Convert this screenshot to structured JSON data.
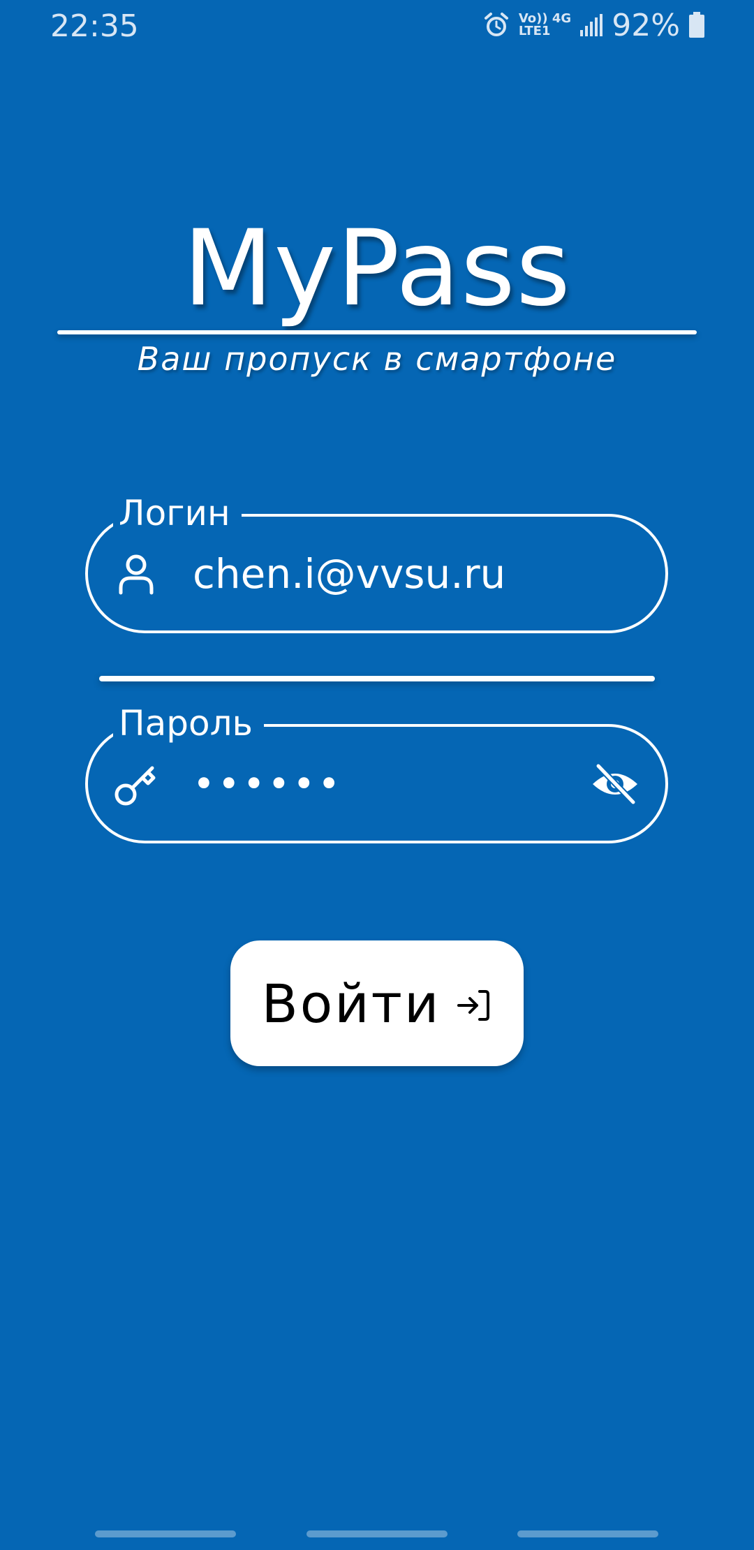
{
  "status_bar": {
    "time": "22:35",
    "network_top": "Vo)) 4G",
    "network_bottom": "LTE1",
    "battery": "92%",
    "icons": [
      "alarm-icon",
      "signal-icon",
      "battery-icon"
    ]
  },
  "header": {
    "title": "MyPass",
    "subtitle": "Ваш пропуск в смартфоне"
  },
  "login_field": {
    "label": "Логин",
    "value": "chen.i@vvsu.ru",
    "icon": "person-icon"
  },
  "password_field": {
    "label": "Пароль",
    "value": "••••••",
    "icon": "key-icon",
    "toggle_icon": "eye-off-icon"
  },
  "login_button": {
    "label": "Войти",
    "icon": "login-arrow-icon"
  },
  "colors": {
    "background": "#0566b4",
    "foreground": "#ffffff",
    "button_background": "#ffffff",
    "button_text": "#000000"
  }
}
